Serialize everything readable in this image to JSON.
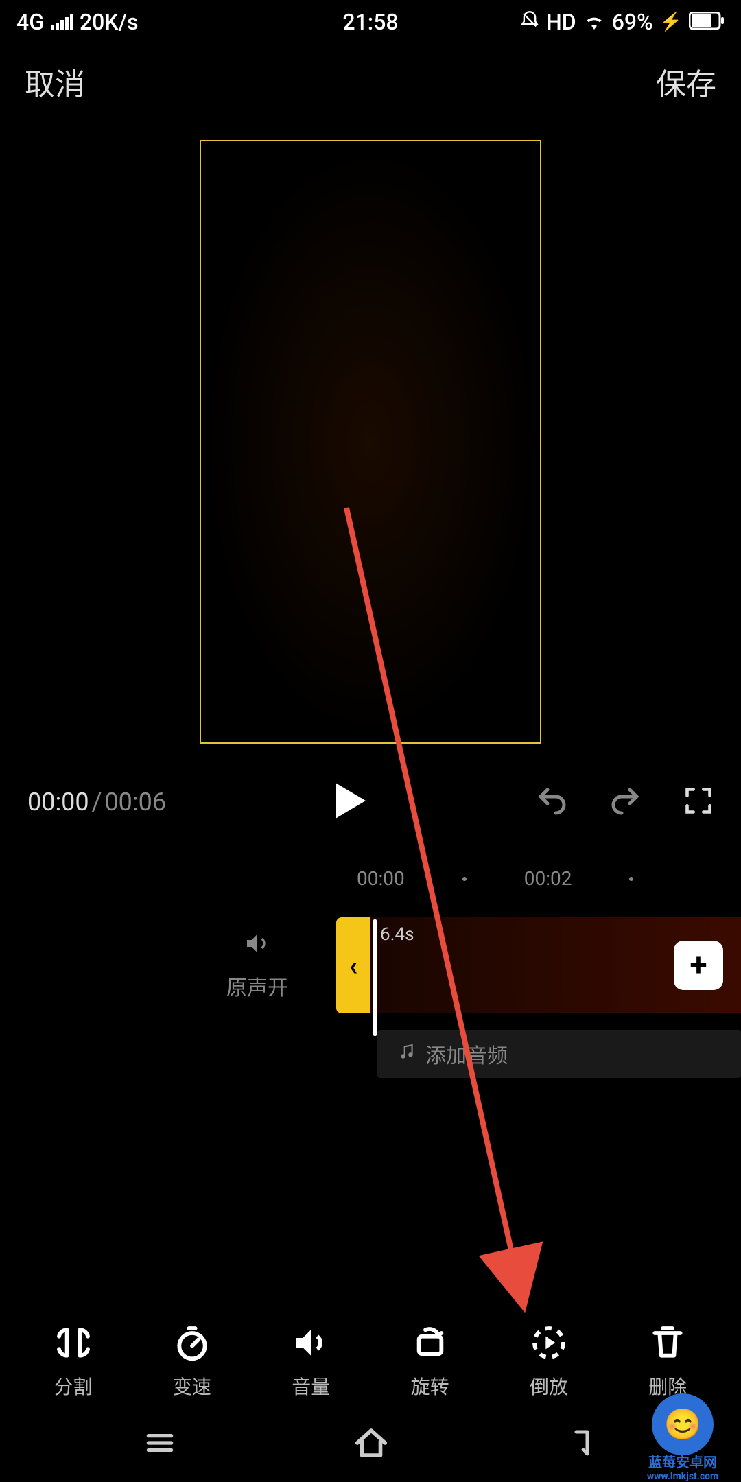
{
  "status_bar": {
    "network": "4G",
    "speed": "20K/s",
    "time": "21:58",
    "hd": "HD",
    "battery": "69%"
  },
  "header": {
    "cancel_label": "取消",
    "save_label": "保存"
  },
  "playback": {
    "current_time": "00:00",
    "separator": "/",
    "total_time": "00:06"
  },
  "ruler": {
    "mark1": "00:00",
    "mark2": "00:02"
  },
  "timeline": {
    "sound_label": "原声开",
    "clip_duration": "6.4s",
    "handle_glyph": "‹",
    "add_glyph": "+"
  },
  "add_audio": {
    "label": "添加音频"
  },
  "toolbar": {
    "items": [
      {
        "label": "分割"
      },
      {
        "label": "变速"
      },
      {
        "label": "音量"
      },
      {
        "label": "旋转"
      },
      {
        "label": "倒放"
      },
      {
        "label": "删除"
      }
    ]
  },
  "watermark": {
    "emoji": "😊",
    "line1": "蓝莓安卓网",
    "line2": "www.lmkjst.com"
  }
}
